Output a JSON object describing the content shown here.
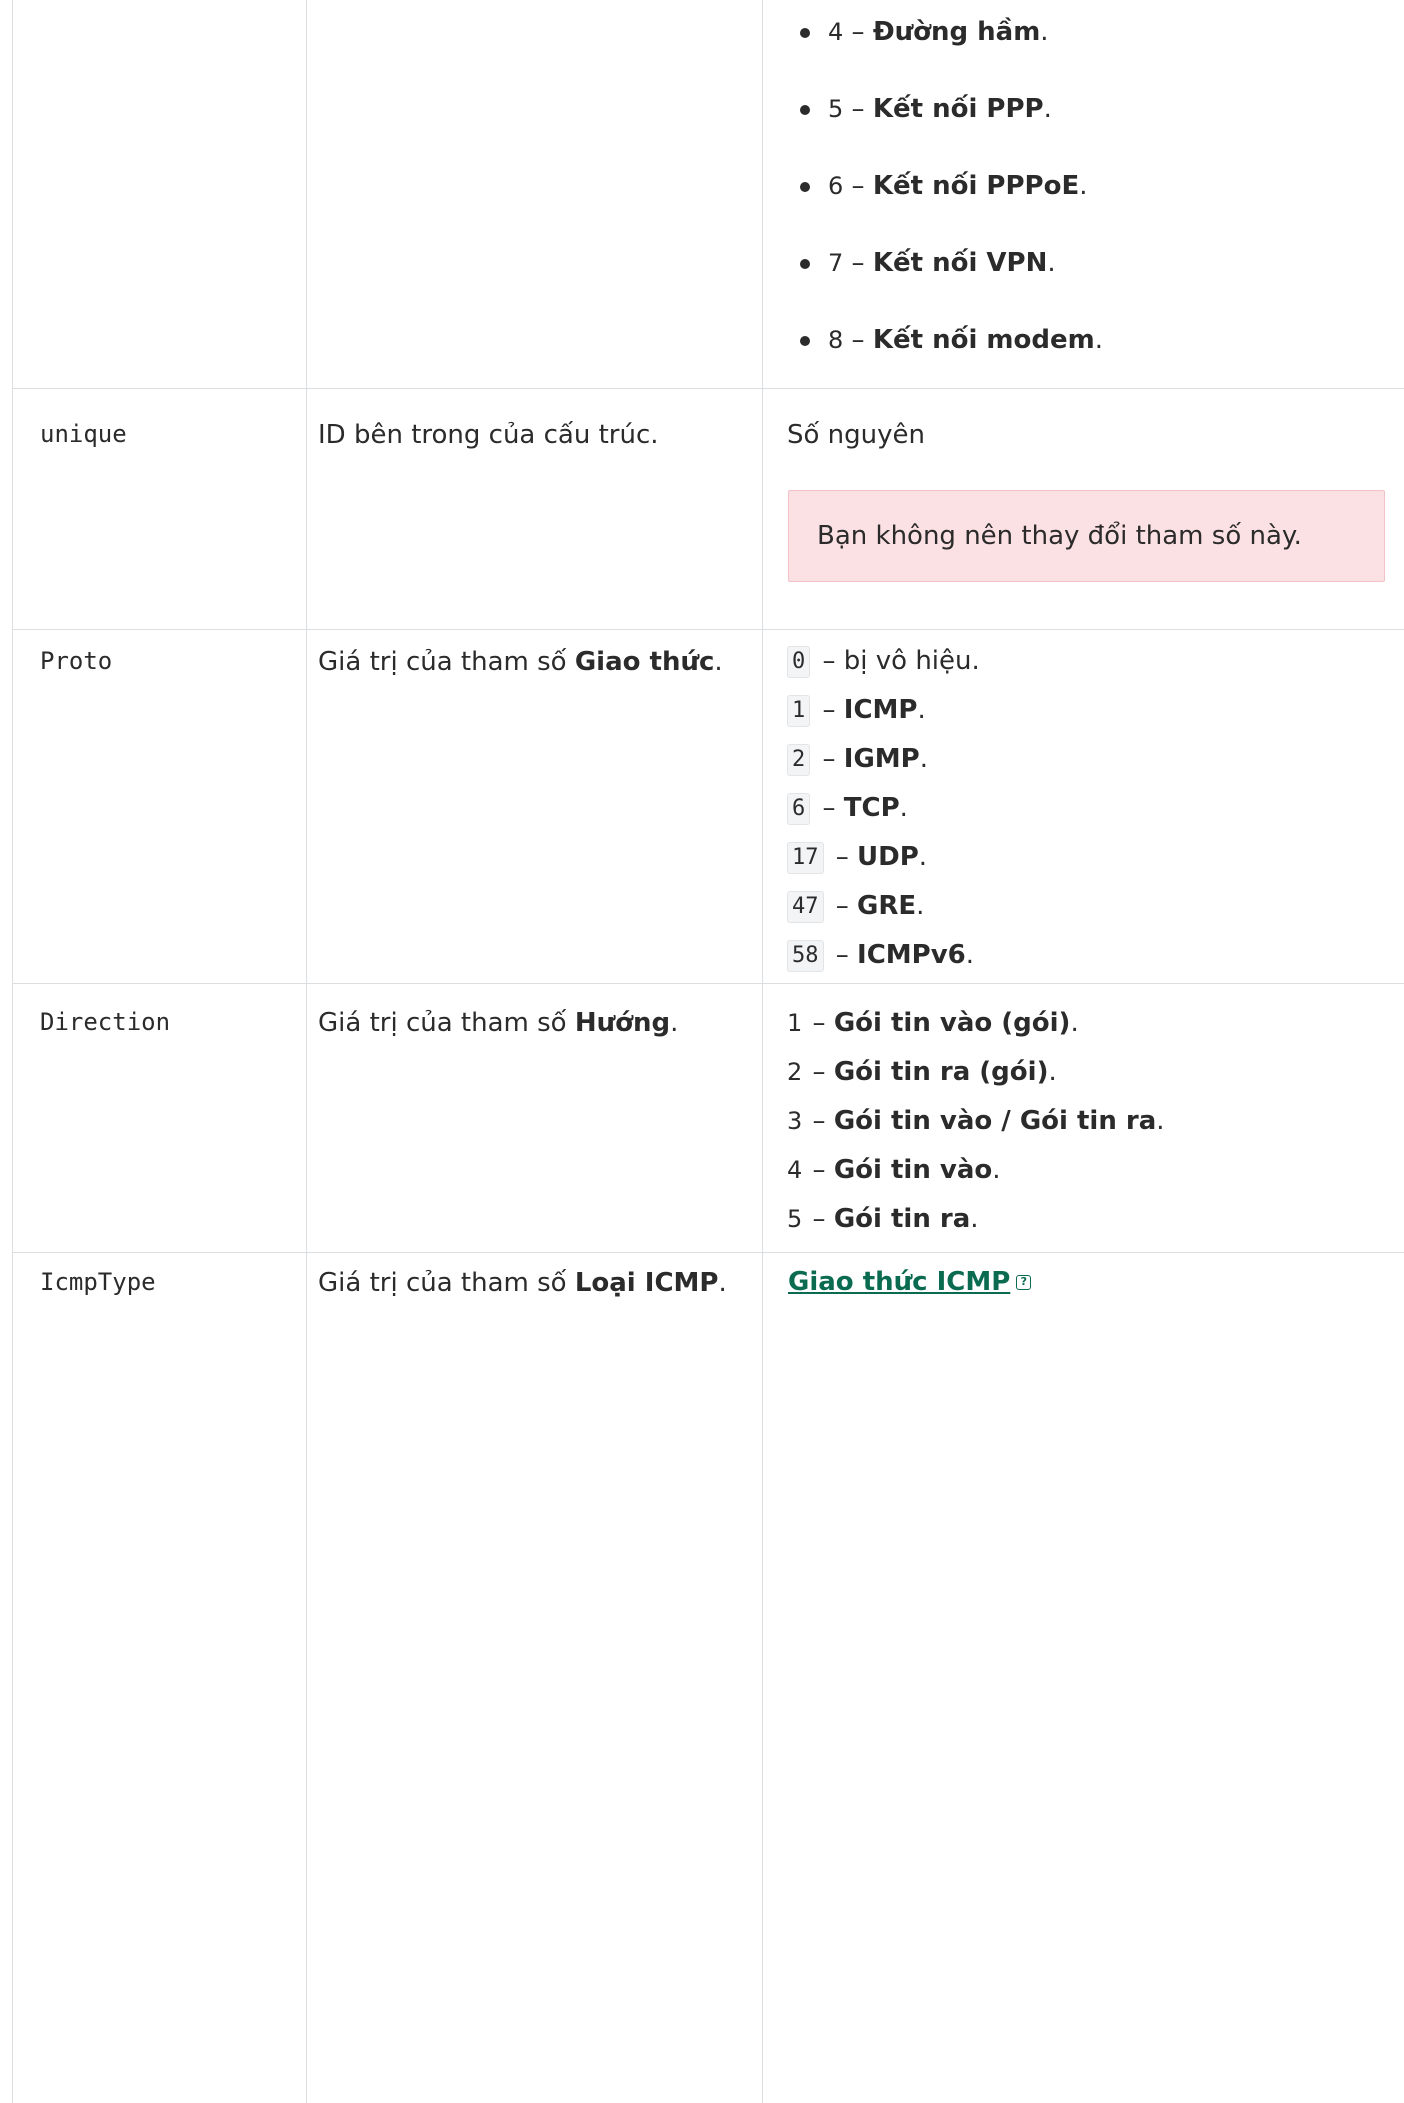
{
  "bullets": [
    {
      "num": "4",
      "sep": "–",
      "label": "Đường hầm",
      "end": "."
    },
    {
      "num": "5",
      "sep": "–",
      "label": "Kết nối PPP",
      "end": "."
    },
    {
      "num": "6",
      "sep": "–",
      "label": "Kết nối PPPoE",
      "end": "."
    },
    {
      "num": "7",
      "sep": "–",
      "label": "Kết nối VPN",
      "end": "."
    },
    {
      "num": "8",
      "sep": "–",
      "label": "Kết nối modem",
      "end": "."
    }
  ],
  "rows": {
    "unique": {
      "name": "unique",
      "desc": "ID bên trong của cấu trúc.",
      "value": "Số nguyên",
      "warning": "Bạn không nên thay đổi tham số này."
    },
    "proto": {
      "name": "Proto",
      "desc_prefix": "Giá trị của tham số ",
      "desc_bold": "Giao thức",
      "desc_suffix": ".",
      "values": [
        {
          "code": "0",
          "text": " – bị vô hiệu.",
          "bold": "",
          "end": ""
        },
        {
          "code": "1",
          "text": " – ",
          "bold": "ICMP",
          "end": "."
        },
        {
          "code": "2",
          "text": " – ",
          "bold": "IGMP",
          "end": "."
        },
        {
          "code": "6",
          "text": " – ",
          "bold": "TCP",
          "end": "."
        },
        {
          "code": "17",
          "text": " – ",
          "bold": "UDP",
          "end": "."
        },
        {
          "code": "47",
          "text": " – ",
          "bold": "GRE",
          "end": "."
        },
        {
          "code": "58",
          "text": " – ",
          "bold": "ICMPv6",
          "end": "."
        }
      ]
    },
    "direction": {
      "name": "Direction",
      "desc_prefix": "Giá trị của tham số ",
      "desc_bold": "Hướng",
      "desc_suffix": ".",
      "values": [
        {
          "num": "1",
          "text": " – ",
          "bold": "Gói tin vào (gói)",
          "end": "."
        },
        {
          "num": "2",
          "text": " – ",
          "bold": "Gói tin ra (gói)",
          "end": "."
        },
        {
          "num": "3",
          "text": " – ",
          "bold": "Gói tin vào / Gói tin ra",
          "end": "."
        },
        {
          "num": "4",
          "text": " – ",
          "bold": "Gói tin vào",
          "end": "."
        },
        {
          "num": "5",
          "text": " – ",
          "bold": "Gói tin ra",
          "end": "."
        }
      ]
    },
    "icmp": {
      "name": "IcmpType",
      "desc_prefix": "Giá trị của tham số ",
      "desc_bold": "Loại ICMP",
      "desc_suffix": ".",
      "link": "Giao thức ICMP",
      "link_icon": "?"
    }
  }
}
